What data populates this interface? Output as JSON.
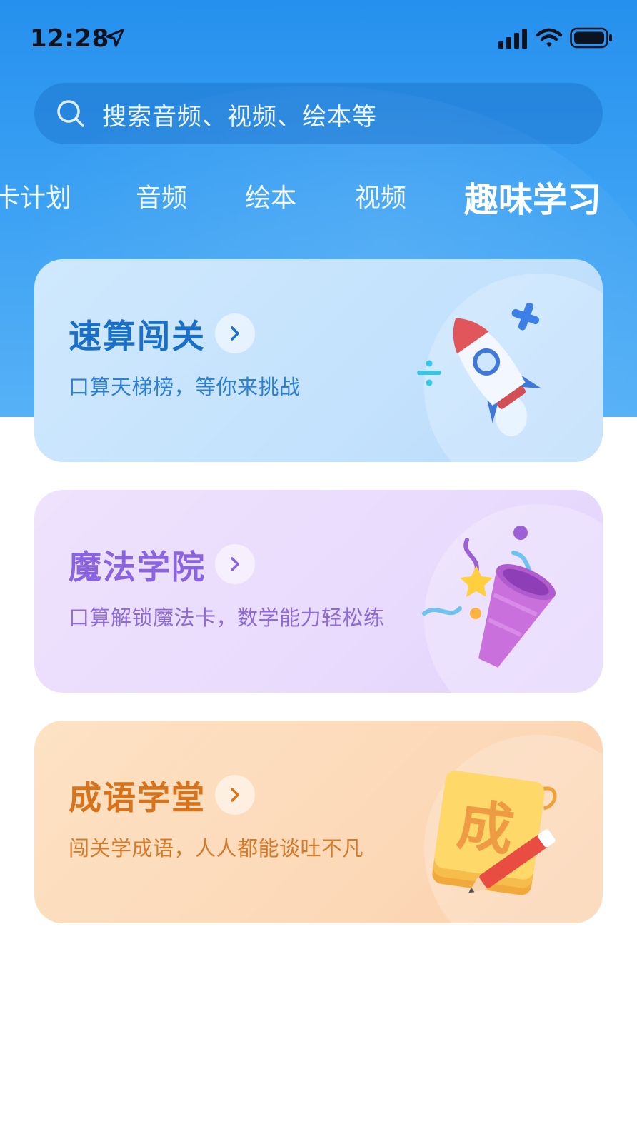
{
  "status_bar": {
    "time": "12:28"
  },
  "search": {
    "placeholder": "搜索音频、视频、绘本等"
  },
  "tabs": [
    {
      "label": "卡计划",
      "active": false
    },
    {
      "label": "音频",
      "active": false
    },
    {
      "label": "绘本",
      "active": false
    },
    {
      "label": "视频",
      "active": false
    },
    {
      "label": "趣味学习",
      "active": true
    }
  ],
  "cards": [
    {
      "title": "速算闯关",
      "subtitle": "口算天梯榜，等你来挑战",
      "illustration": "rocket-icon",
      "color": "#1a6fc9"
    },
    {
      "title": "魔法学院",
      "subtitle": "口算解锁魔法卡，数学能力轻松练",
      "illustration": "party-popper-icon",
      "color": "#8a63e0"
    },
    {
      "title": "成语学堂",
      "subtitle": "闯关学成语，人人都能谈吐不凡",
      "illustration": "notepad-pencil-icon",
      "illustration_glyph": "成",
      "color": "#d8731c"
    }
  ],
  "colors": {
    "hero_blue": "#2590ee",
    "white": "#ffffff"
  }
}
